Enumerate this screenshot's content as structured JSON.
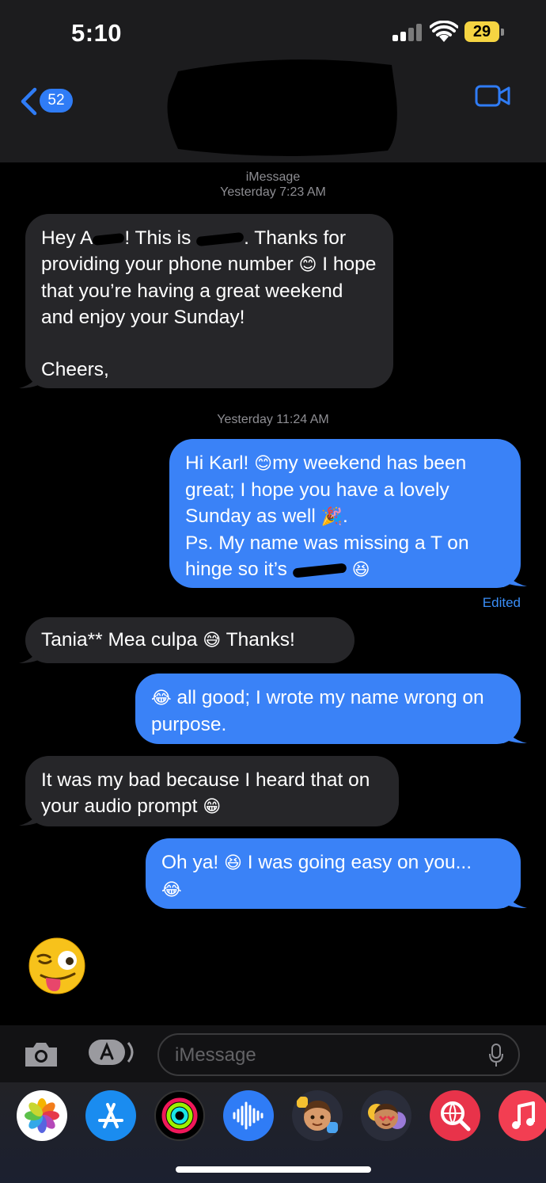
{
  "status_bar": {
    "time": "5:10",
    "battery": "29"
  },
  "header": {
    "back_count": "52",
    "contact_name_redacted": true
  },
  "thread": [
    {
      "type": "meta",
      "service": "iMessage",
      "timestamp": "Yesterday 7:23 AM"
    },
    {
      "type": "incoming",
      "parts": [
        "Hey A",
        "[redacted]",
        "! This is ",
        "[redacted]",
        ". Thanks for providing your phone number ",
        "😊",
        " I hope that you’re having a great weekend and enjoy your Sunday!",
        "\n\nCheers,"
      ]
    },
    {
      "type": "meta",
      "timestamp": "Yesterday 11:24 AM"
    },
    {
      "type": "outgoing",
      "parts": [
        "Hi Karl! ",
        "😊",
        "my weekend has been great; I hope you have a lovely Sunday as well ",
        "🎉",
        ".\nPs. My name was missing a T on hinge so it’s ",
        "[redacted]",
        " ",
        "😆"
      ],
      "edited_label": "Edited"
    },
    {
      "type": "incoming",
      "parts": [
        "Tania** Mea culpa ",
        "😅",
        " Thanks!"
      ]
    },
    {
      "type": "outgoing",
      "parts": [
        "😂",
        " all good; I wrote my name wrong on purpose."
      ]
    },
    {
      "type": "incoming",
      "parts": [
        "It was my bad because I heard that on your audio prompt ",
        "😁"
      ]
    },
    {
      "type": "outgoing",
      "parts": [
        "Oh ya! ",
        "😆",
        " I was going easy on you...\n",
        "😂"
      ]
    },
    {
      "type": "emoji_only",
      "emoji": "😜"
    }
  ],
  "input": {
    "placeholder": "iMessage"
  },
  "app_drawer": [
    {
      "name": "photos-app-icon"
    },
    {
      "name": "app-store-icon"
    },
    {
      "name": "fitness-activity-icon"
    },
    {
      "name": "audio-message-icon"
    },
    {
      "name": "memoji-icon"
    },
    {
      "name": "memoji-stickers-icon"
    },
    {
      "name": "web-images-search-icon"
    },
    {
      "name": "music-app-icon"
    }
  ],
  "colors": {
    "outgoing_bubble": "#3a82f7",
    "incoming_bubble": "#262629",
    "accent": "#2f7cf6",
    "battery": "#f5d442"
  }
}
